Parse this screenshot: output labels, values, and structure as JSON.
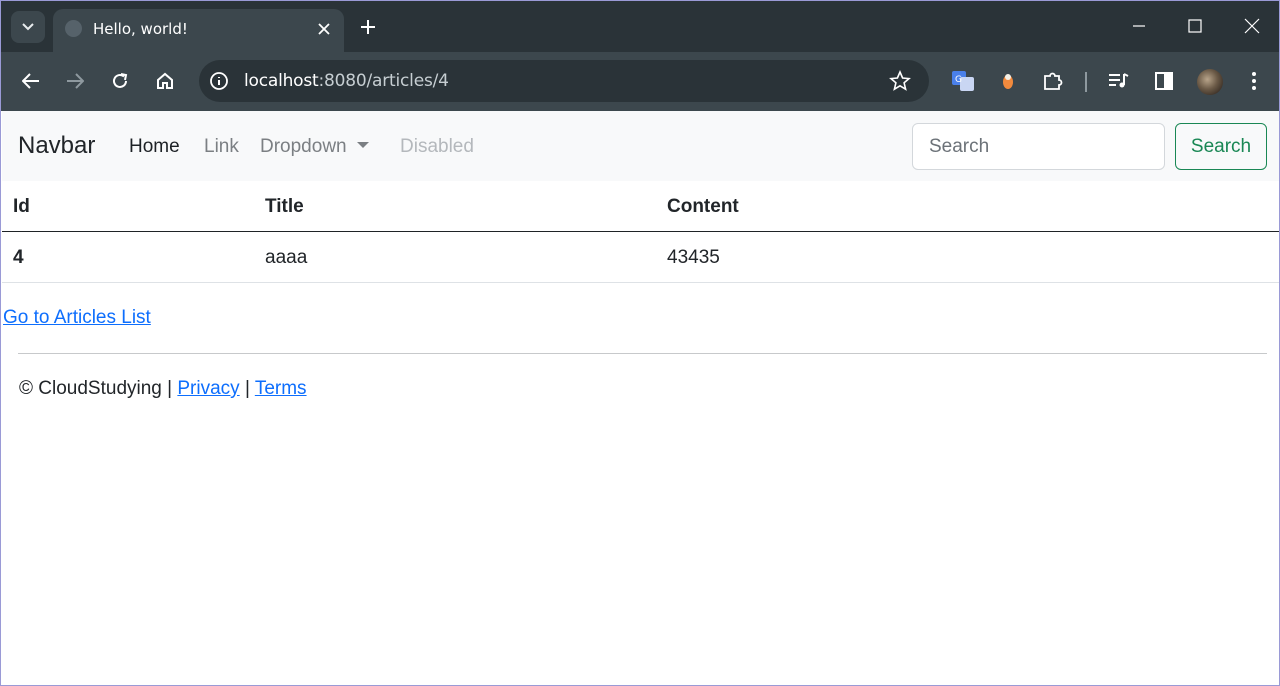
{
  "browser": {
    "tab_title": "Hello, world!",
    "url_host": "localhost",
    "url_rest": ":8080/articles/4",
    "colors": {
      "tabstrip": "#2a3338",
      "toolbar": "#3c474d"
    }
  },
  "navbar": {
    "brand": "Navbar",
    "links": [
      {
        "label": "Home",
        "state": "active"
      },
      {
        "label": "Link",
        "state": "normal"
      },
      {
        "label": "Dropdown",
        "state": "dropdown"
      },
      {
        "label": "Disabled",
        "state": "disabled"
      }
    ],
    "search_placeholder": "Search",
    "search_button": "Search"
  },
  "table": {
    "headers": [
      "Id",
      "Title",
      "Content"
    ],
    "rows": [
      [
        "4",
        "aaaa",
        "43435"
      ]
    ]
  },
  "page": {
    "back_link": "Go to Articles List",
    "footer_copyright": "© CloudStudying",
    "footer_sep": "|",
    "footer_privacy": "Privacy",
    "footer_terms": "Terms"
  },
  "icons": [
    "tab-search-icon",
    "globe-icon",
    "close-icon",
    "plus-icon",
    "minimize-icon",
    "maximize-icon",
    "back-arrow-icon",
    "forward-arrow-icon",
    "reload-icon",
    "home-icon",
    "info-icon",
    "star-icon",
    "translate-icon",
    "extension-icon",
    "puzzle-icon",
    "media-icon",
    "side-panel-icon",
    "profile-avatar",
    "more-icon"
  ]
}
